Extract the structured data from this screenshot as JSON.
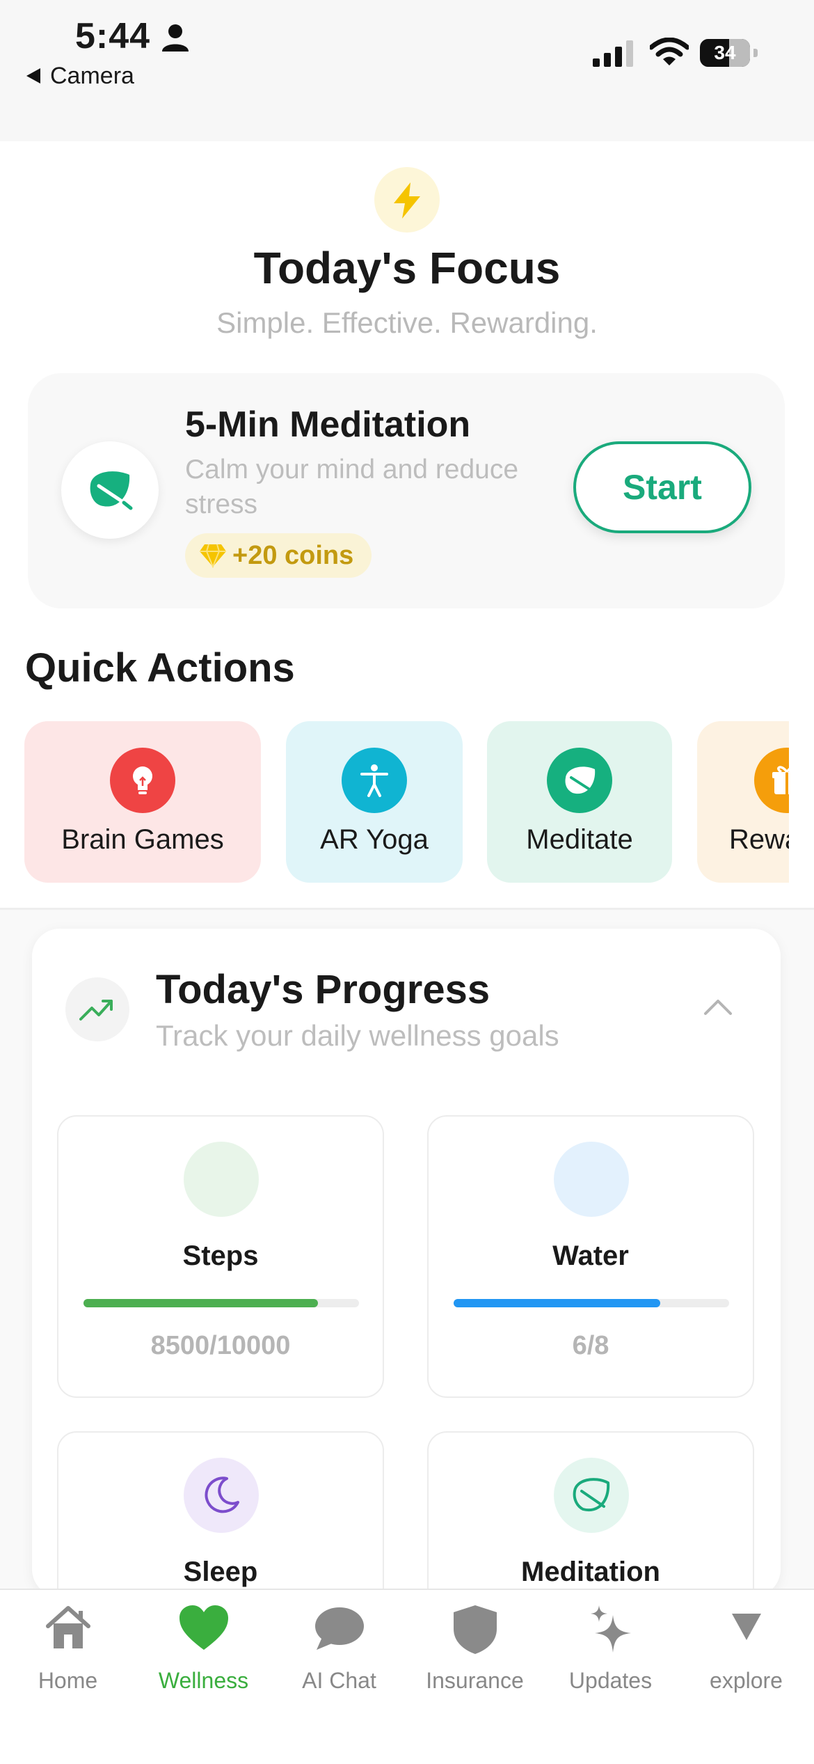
{
  "status_bar": {
    "time": "5:44",
    "back_label": "Camera",
    "battery": "34"
  },
  "focus": {
    "icon": "lightning-icon",
    "title": "Today's Focus",
    "subtitle": "Simple. Effective. Rewarding."
  },
  "meditation_card": {
    "icon": "leaf-icon",
    "title": "5-Min Meditation",
    "description": "Calm your mind and reduce stress",
    "coins": "+20 coins",
    "start_label": "Start"
  },
  "quick_actions": {
    "title": "Quick Actions",
    "items": [
      {
        "label": "Brain Games",
        "icon": "lightbulb-icon",
        "bg": "#fde6e6",
        "accent": "#ef4444"
      },
      {
        "label": "AR Yoga",
        "icon": "person-pose-icon",
        "bg": "#e0f5f9",
        "accent": "#10b4d2"
      },
      {
        "label": "Meditate",
        "icon": "leaf-icon",
        "bg": "#e2f5ee",
        "accent": "#16b07f"
      },
      {
        "label": "Rewa",
        "icon": "gift-icon",
        "bg": "#fdf2e2",
        "accent": "#f59e0b"
      }
    ]
  },
  "progress": {
    "icon": "trending-up-icon",
    "title": "Today's Progress",
    "subtitle": "Track your daily wellness goals",
    "metrics": [
      {
        "label": "Steps",
        "value": "8500/10000",
        "fraction": 0.85,
        "color": "#4caf50",
        "circle_bg": "#e8f5e9"
      },
      {
        "label": "Water",
        "value": "6/8",
        "fraction": 0.75,
        "color": "#2196f3",
        "circle_bg": "#e3f1fd"
      },
      {
        "label": "Sleep",
        "icon": "moon-icon",
        "circle_bg": "#efe8fa",
        "color": "#7c4dcc"
      },
      {
        "label": "Meditation",
        "icon": "leaf-outline-icon",
        "circle_bg": "#e4f6ef",
        "color": "#1aaa7c"
      }
    ]
  },
  "bottom_nav": {
    "items": [
      {
        "label": "Home",
        "icon": "home-icon"
      },
      {
        "label": "Wellness",
        "icon": "heart-icon",
        "active": true
      },
      {
        "label": "AI Chat",
        "icon": "chat-bubble-icon"
      },
      {
        "label": "Insurance",
        "icon": "shield-icon"
      },
      {
        "label": "Updates",
        "icon": "sparkle-icon"
      },
      {
        "label": "explore",
        "icon": "triangle-down-icon"
      }
    ]
  }
}
